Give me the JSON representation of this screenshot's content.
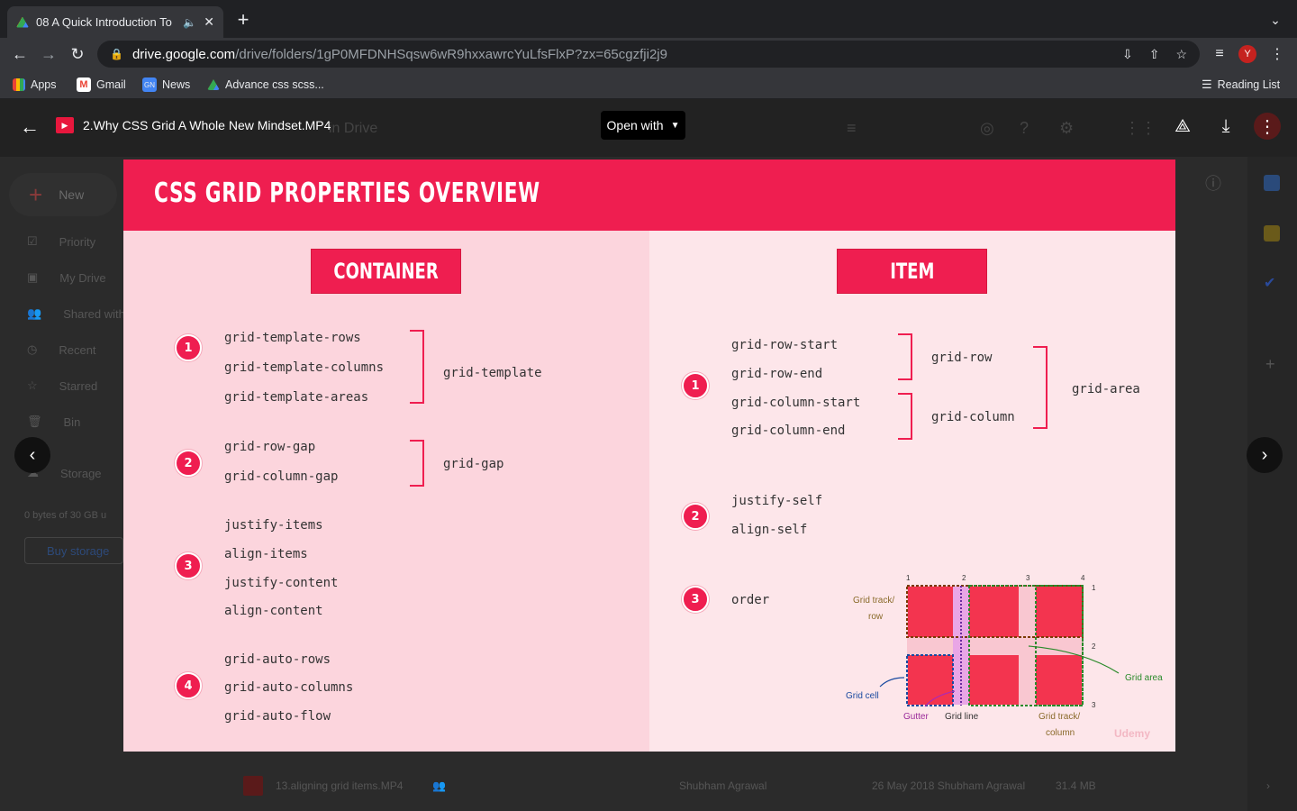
{
  "browser": {
    "tab_title": "08 A Quick Introduction To",
    "url_host": "drive.google.com",
    "url_path": "/drive/folders/1gP0MFDNHSqsw6wR9hxxawrcYuLfsFlxP?zx=65cgzfji2j9",
    "avatar_letter": "Y",
    "bookmarks": [
      {
        "label": "Apps",
        "icon": "apps-grid-icon"
      },
      {
        "label": "Gmail",
        "icon": "gmail-icon"
      },
      {
        "label": "News",
        "icon": "news-icon"
      },
      {
        "label": "Advance css scss...",
        "icon": "drive-icon"
      }
    ],
    "reading_list": "Reading List"
  },
  "drive": {
    "new_button": "New",
    "sidebar": [
      "Priority",
      "My Drive",
      "Shared with",
      "Recent",
      "Starred",
      "Bin",
      "Storage"
    ],
    "storage_text": "0 bytes of 30 GB u",
    "buy_storage": "Buy storage",
    "header_fragment": "in Drive",
    "file_row": {
      "name": "13.aligning grid items.MP4",
      "owner": "Shubham Agrawal",
      "modified": "26 May 2018 Shubham Agrawal",
      "size": "31.4 MB"
    }
  },
  "viewer": {
    "file_title": "2.Why CSS Grid A Whole New Mindset.MP4",
    "open_with": "Open with"
  },
  "slide": {
    "title": "CSS GRID PROPERTIES OVERVIEW",
    "container": {
      "heading": "CONTAINER",
      "groups": [
        {
          "num": "1",
          "props": [
            "grid-template-rows",
            "grid-template-columns",
            "grid-template-areas"
          ],
          "shorthand": "grid-template"
        },
        {
          "num": "2",
          "props": [
            "grid-row-gap",
            "grid-column-gap"
          ],
          "shorthand": "grid-gap"
        },
        {
          "num": "3",
          "props": [
            "justify-items",
            "align-items",
            "justify-content",
            "align-content"
          ]
        },
        {
          "num": "4",
          "props": [
            "grid-auto-rows",
            "grid-auto-columns",
            "grid-auto-flow"
          ]
        }
      ]
    },
    "item": {
      "heading": "ITEM",
      "group1": {
        "num": "1",
        "props": [
          "grid-row-start",
          "grid-row-end",
          "grid-column-start",
          "grid-column-end"
        ],
        "row_short": "grid-row",
        "col_short": "grid-column",
        "area": "grid-area"
      },
      "group2": {
        "num": "2",
        "props": [
          "justify-self",
          "align-self"
        ]
      },
      "group3": {
        "num": "3",
        "props": [
          "order"
        ]
      }
    },
    "diagram": {
      "labels": {
        "track_row": "Grid track/",
        "track_row2": "row",
        "cell": "Grid cell",
        "gutter": "Gutter",
        "line": "Grid line",
        "track_col": "Grid track/",
        "track_col2": "column",
        "area": "Grid area"
      },
      "col_numbers": [
        "1",
        "2",
        "3",
        "4"
      ],
      "row_numbers": [
        "1",
        "2",
        "3"
      ],
      "watermark": "Udemy"
    },
    "colors": {
      "accent": "#ef1e50",
      "left_bg": "#fcd5dd",
      "right_bg": "#fde6ea"
    }
  }
}
